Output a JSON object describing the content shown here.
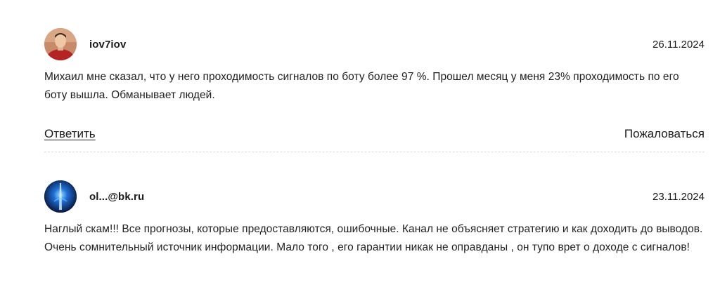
{
  "comments": [
    {
      "author": "iov7iov",
      "avatar_icon": "user-photo-avatar",
      "date": "26.11.2024",
      "text": "Михаил мне сказал, что у него проходимость сигналов по боту более 97 %. Прошел месяц у меня 23% проходимость по его боту вышла. Обманывает людей.",
      "reply_label": "Ответить",
      "report_label": "Пожаловаться"
    },
    {
      "author": "ol...@bk.ru",
      "avatar_icon": "blue-abstract-avatar",
      "date": "23.11.2024",
      "text": "Наглый скам!!! Все прогнозы, которые предоставляются, ошибочные. Канал не объясняет стратегию и как доходить до выводов. Очень сомнительный источник информации. Мало того , его гарантии никак не оправданы , он тупо врет о доходе с сигналов!"
    }
  ],
  "colors": {
    "text": "#1a1a1a",
    "divider": "#d9d9d9",
    "avatar1_bg": "#c98a6a",
    "avatar2_bg": "#0a1a4a"
  }
}
